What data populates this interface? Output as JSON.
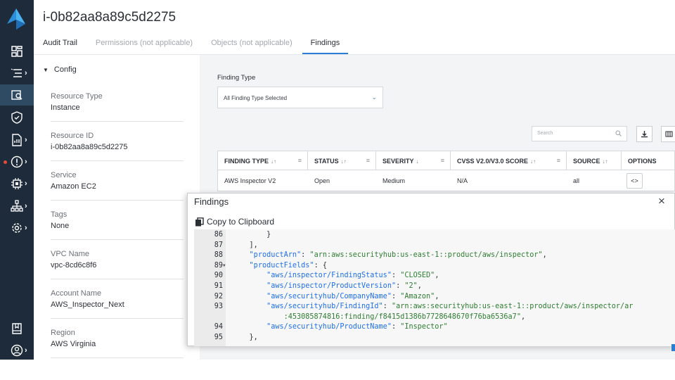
{
  "colors": {
    "rail_bg": "#1d2b3a",
    "accent": "#2a7fd4",
    "content_bg": "#f3f4f6",
    "json_key": "#1f6feb",
    "json_value": "#2e7d32"
  },
  "header": {
    "title": "i-0b82aa8a89c5d2275"
  },
  "tabs": [
    {
      "label": "Audit Trail",
      "state": "normal"
    },
    {
      "label": "Permissions (not applicable)",
      "state": "disabled"
    },
    {
      "label": "Objects (not applicable)",
      "state": "disabled"
    },
    {
      "label": "Findings",
      "state": "active"
    }
  ],
  "rail": {
    "icons": [
      "logo-icon",
      "dashboard-icon",
      "list-icon",
      "resource-search-icon",
      "shield-icon",
      "report-icon",
      "alert-icon",
      "chip-icon",
      "network-icon",
      "settings-icon",
      "book-icon",
      "user-icon"
    ],
    "expand_glyph": "›",
    "chevron": "›"
  },
  "config": {
    "section_label": "Config",
    "fields": [
      {
        "label": "Resource Type",
        "value": "Instance"
      },
      {
        "label": "Resource ID",
        "value": "i-0b82aa8a89c5d2275"
      },
      {
        "label": "Service",
        "value": "Amazon EC2"
      },
      {
        "label": "Tags",
        "value": "None"
      },
      {
        "label": "VPC Name",
        "value": "vpc-8cd6c8f6"
      },
      {
        "label": "Account Name",
        "value": "AWS_Inspector_Next"
      },
      {
        "label": "Region",
        "value": "AWS Virginia"
      }
    ]
  },
  "filter": {
    "label": "Finding Type",
    "selected": "All Finding Type Selected"
  },
  "search": {
    "placeholder": "Search"
  },
  "table": {
    "columns": [
      {
        "label": "FINDING TYPE",
        "sort": "↓↑",
        "menu": "≡"
      },
      {
        "label": "STATUS",
        "sort": "↓↑",
        "menu": "≡"
      },
      {
        "label": "SEVERITY",
        "sort": "↓",
        "menu": "≡"
      },
      {
        "label": "CVSS V2.0/V3.0 SCORE",
        "sort": "↓↑",
        "menu": "≡"
      },
      {
        "label": "SOURCE",
        "sort": "↓↑",
        "menu": ""
      },
      {
        "label": "OPTIONS",
        "sort": "",
        "menu": ""
      }
    ],
    "rows": [
      {
        "finding_type": "AWS Inspector V2",
        "status": "Open",
        "severity": "Medium",
        "score": "N/A",
        "source": "all",
        "option_glyph": "<>"
      }
    ]
  },
  "modal": {
    "title": "Findings",
    "close": "×",
    "copy_label": "Copy to Clipboard",
    "lines": [
      {
        "n": "86",
        "fold": "",
        "indent": "        ",
        "parts": [
          {
            "c": "s",
            "t": "}"
          }
        ]
      },
      {
        "n": "87",
        "fold": "",
        "indent": "    ",
        "parts": [
          {
            "c": "s",
            "t": "],"
          }
        ]
      },
      {
        "n": "88",
        "fold": "",
        "indent": "    ",
        "parts": [
          {
            "c": "k",
            "t": "\"productArn\""
          },
          {
            "c": "s",
            "t": ": "
          },
          {
            "c": "v",
            "t": "\"arn:aws:securityhub:us-east-1::product/aws/inspector\""
          },
          {
            "c": "s",
            "t": ","
          }
        ]
      },
      {
        "n": "89",
        "fold": "▼",
        "indent": "    ",
        "parts": [
          {
            "c": "k",
            "t": "\"productFields\""
          },
          {
            "c": "s",
            "t": ": {"
          }
        ]
      },
      {
        "n": "90",
        "fold": "",
        "indent": "        ",
        "parts": [
          {
            "c": "k",
            "t": "\"aws/inspector/FindingStatus\""
          },
          {
            "c": "s",
            "t": ": "
          },
          {
            "c": "v",
            "t": "\"CLOSED\""
          },
          {
            "c": "s",
            "t": ","
          }
        ]
      },
      {
        "n": "91",
        "fold": "",
        "indent": "        ",
        "parts": [
          {
            "c": "k",
            "t": "\"aws/inspector/ProductVersion\""
          },
          {
            "c": "s",
            "t": ": "
          },
          {
            "c": "v",
            "t": "\"2\""
          },
          {
            "c": "s",
            "t": ","
          }
        ]
      },
      {
        "n": "92",
        "fold": "",
        "indent": "        ",
        "parts": [
          {
            "c": "k",
            "t": "\"aws/securityhub/CompanyName\""
          },
          {
            "c": "s",
            "t": ": "
          },
          {
            "c": "v",
            "t": "\"Amazon\""
          },
          {
            "c": "s",
            "t": ","
          }
        ]
      },
      {
        "n": "93",
        "fold": "",
        "indent": "        ",
        "parts": [
          {
            "c": "k",
            "t": "\"aws/securityhub/FindingId\""
          },
          {
            "c": "s",
            "t": ": "
          },
          {
            "c": "v",
            "t": "\"arn:aws:securityhub:us-east-1::product/aws/inspector/ar"
          }
        ]
      },
      {
        "n": "",
        "fold": "",
        "indent": "            ",
        "parts": [
          {
            "c": "v",
            "t": ":453085874816:finding/f8415d1386b7728648670f76ba6536a7\""
          },
          {
            "c": "s",
            "t": ","
          }
        ]
      },
      {
        "n": "94",
        "fold": "",
        "indent": "        ",
        "parts": [
          {
            "c": "k",
            "t": "\"aws/securityhub/ProductName\""
          },
          {
            "c": "s",
            "t": ": "
          },
          {
            "c": "v",
            "t": "\"Inspector\""
          }
        ]
      },
      {
        "n": "95",
        "fold": "",
        "indent": "    ",
        "parts": [
          {
            "c": "s",
            "t": "},"
          }
        ]
      }
    ]
  }
}
